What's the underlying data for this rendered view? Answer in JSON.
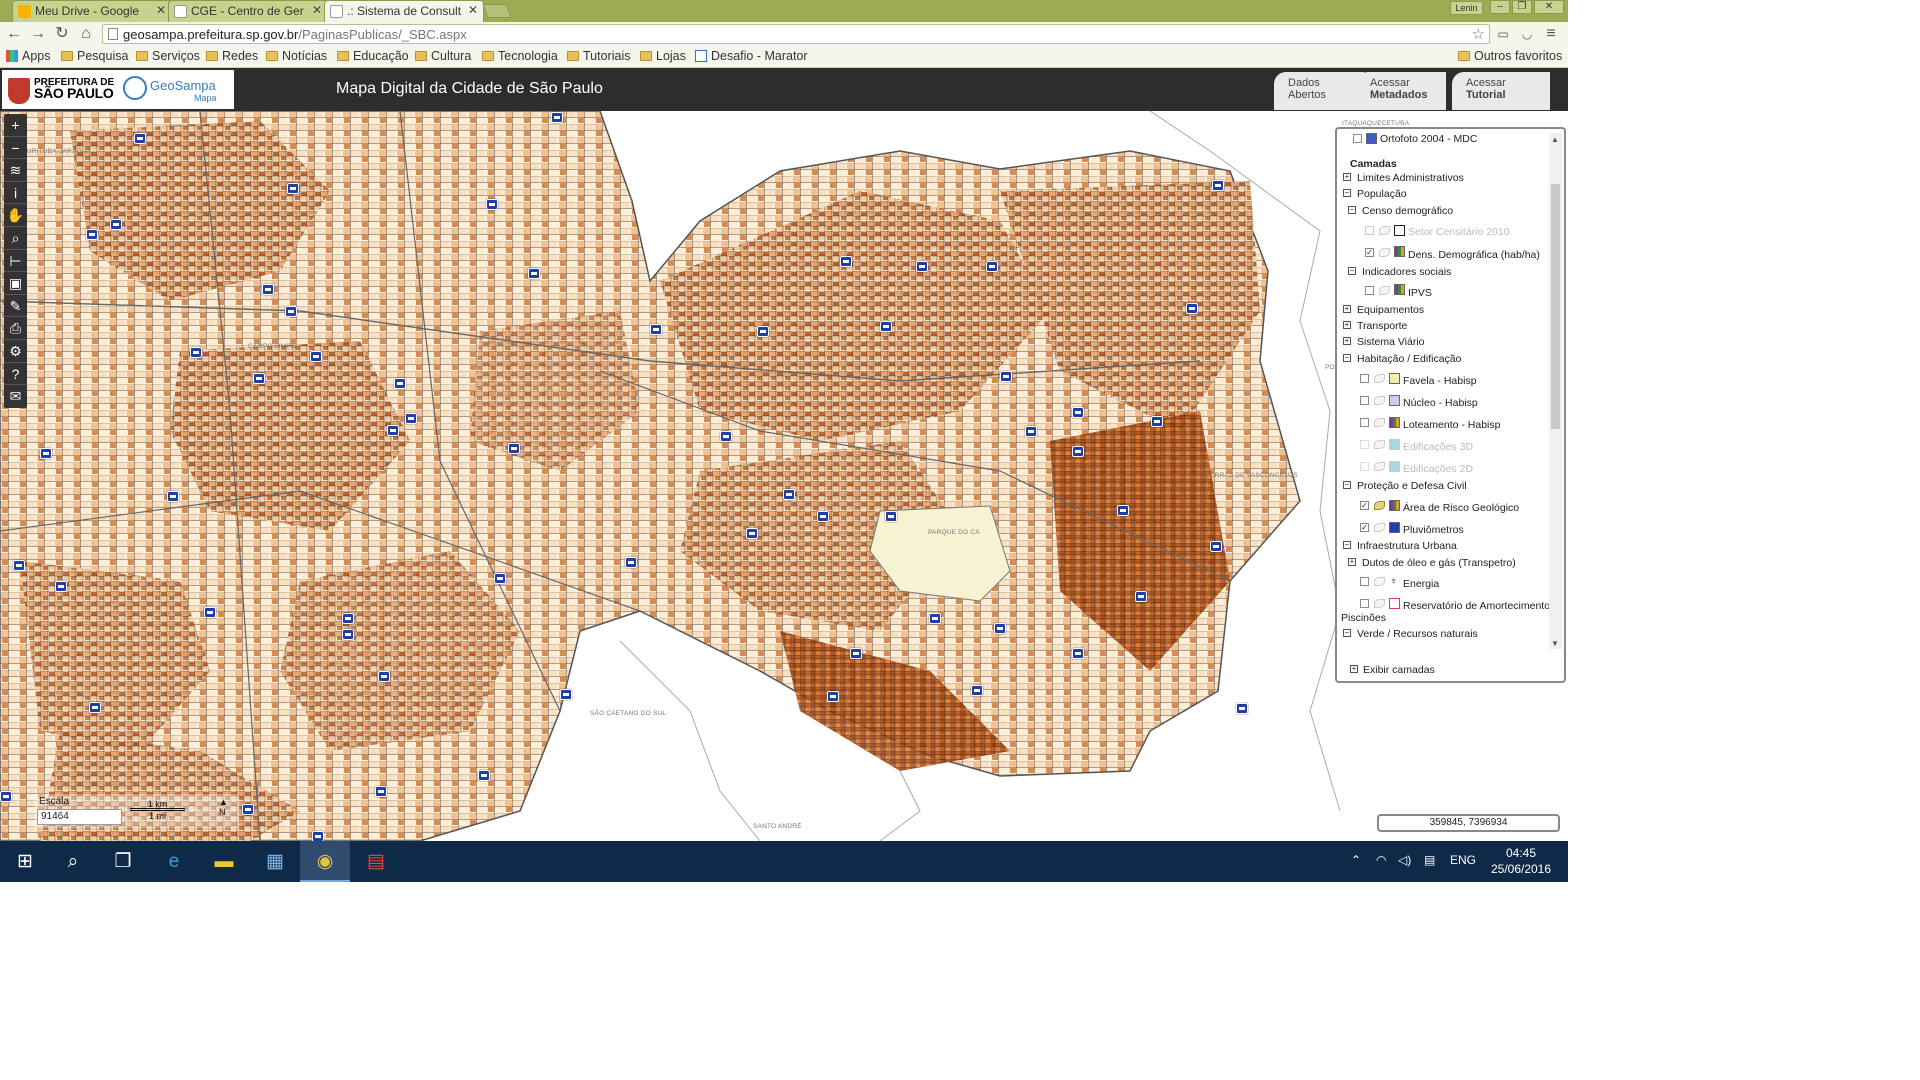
{
  "browser": {
    "tabs": [
      {
        "title": "Meu Drive - Google",
        "active": false,
        "icon_color": "#f4b400"
      },
      {
        "title": "CGE - Centro de Ger",
        "active": false,
        "icon_color": "#ffffff"
      },
      {
        "title": ".: Sistema de Consult",
        "active": true,
        "icon_color": "#ffffff"
      }
    ],
    "profile": "Lenin",
    "url_host": "geosampa.prefeitura.sp.gov.br",
    "url_path": "/PaginasPublicas/_SBC.aspx",
    "bookmarks": [
      {
        "label": "Apps",
        "icon": "apps-icon"
      },
      {
        "label": "Pesquisa",
        "icon": "folder-icon"
      },
      {
        "label": "Serviços",
        "icon": "folder-icon"
      },
      {
        "label": "Redes",
        "icon": "folder-icon"
      },
      {
        "label": "Notícias",
        "icon": "folder-icon"
      },
      {
        "label": "Educação",
        "icon": "folder-icon"
      },
      {
        "label": "Cultura",
        "icon": "folder-icon"
      },
      {
        "label": "Tecnologia",
        "icon": "folder-icon"
      },
      {
        "label": "Tutoriais",
        "icon": "folder-icon"
      },
      {
        "label": "Lojas",
        "icon": "folder-icon"
      },
      {
        "label": "Desafio - Marator",
        "icon": "calendar-icon"
      }
    ],
    "other_bookmarks": "Outros favoritos"
  },
  "header": {
    "pref_line1": "PREFEITURA DE",
    "pref_line2": "SÃO PAULO",
    "geosampa_name": "GeoSampa",
    "geosampa_sub": "Mapa",
    "title": "Mapa Digital da Cidade de São Paulo",
    "buttons": [
      {
        "line1": "Dados",
        "line2": "Abertos"
      },
      {
        "line1": "Acessar",
        "line2": "Metadados"
      },
      {
        "line1": "Acessar",
        "line2": "Tutorial"
      }
    ]
  },
  "map": {
    "place_labels": [
      "CURITUBA-JARAGUA",
      "CAMPO LIMPO",
      "ITAQUAQUECETUBA",
      "PARQUE DO CA",
      "FERRAZ DE VASCONCELOS",
      "SÃO CAETANO DO SUL",
      "SANTO ANDRÉ",
      "POÁ"
    ],
    "tools": [
      {
        "name": "zoom-in-icon",
        "glyph": "+"
      },
      {
        "name": "zoom-out-icon",
        "glyph": "−"
      },
      {
        "name": "layers-icon",
        "glyph": "≋"
      },
      {
        "name": "info-icon",
        "glyph": "i"
      },
      {
        "name": "pan-icon",
        "glyph": "✋"
      },
      {
        "name": "search-icon",
        "glyph": "⌕"
      },
      {
        "name": "measure-icon",
        "glyph": "⊢"
      },
      {
        "name": "save-icon",
        "glyph": "▣"
      },
      {
        "name": "draw-icon",
        "glyph": "✎"
      },
      {
        "name": "print-icon",
        "glyph": "⎙"
      },
      {
        "name": "settings-icon",
        "glyph": "⚙"
      },
      {
        "name": "help-icon",
        "glyph": "?"
      },
      {
        "name": "mail-icon",
        "glyph": "✉"
      }
    ],
    "scale_label": "Escala",
    "scale_value": "91464",
    "scale_km": "1 km",
    "scale_mi": "1 mi",
    "north": "N",
    "coordinates": "359845, 7396934"
  },
  "layers": {
    "top_item": "Ortofoto 2004 - MDC",
    "heading": "Camadas",
    "items": [
      {
        "label": "Limites Administrativos"
      },
      {
        "label": "População"
      },
      {
        "label": "Censo demográfico"
      },
      {
        "label": "Setor Censitário 2010"
      },
      {
        "label": "Dens. Demográfica (hab/ha)"
      },
      {
        "label": "Indicadores sociais"
      },
      {
        "label": "IPVS"
      },
      {
        "label": "Equipamentos"
      },
      {
        "label": "Transporte"
      },
      {
        "label": "Sistema Viário"
      },
      {
        "label": "Habitação / Edificação"
      },
      {
        "label": "Favela - Habisp"
      },
      {
        "label": "Núcleo - Habisp"
      },
      {
        "label": "Loteamento - Habisp"
      },
      {
        "label": "Edificações 3D"
      },
      {
        "label": "Edificações 2D"
      },
      {
        "label": "Proteção e Defesa Civil"
      },
      {
        "label": "Área de Risco Geológico"
      },
      {
        "label": "Pluviômetros"
      },
      {
        "label": "Infraestrutura Urbana"
      },
      {
        "label": "Dutos de óleo e gás (Transpetro)"
      },
      {
        "label": "Energia"
      },
      {
        "label": "Reservatório de Amortecimento"
      },
      {
        "label": "Piscinões"
      },
      {
        "label": "Verde / Recursos naturais"
      }
    ],
    "footer": "Exibir camadas",
    "checks": {
      "dens": true,
      "setor": false,
      "ipvs": false,
      "favela": false,
      "nucleo": false,
      "loteamento": false,
      "ed3d": false,
      "ed2d": false,
      "risco": true,
      "pluviometros": true,
      "energia": false,
      "reservatorio": false
    },
    "swatch_colors": {
      "favela": "#f2eeb0",
      "nucleo": "#c6cff2",
      "reservatorio": "#e04040",
      "ortofoto": "#3b5ccf"
    }
  },
  "taskbar": {
    "language": "ENG",
    "time": "04:45",
    "date": "25/06/2016",
    "apps": [
      "start-icon",
      "search-icon",
      "task-view-icon",
      "edge-icon",
      "file-explorer-icon",
      "store-icon",
      "chrome-icon",
      "app-icon"
    ]
  }
}
